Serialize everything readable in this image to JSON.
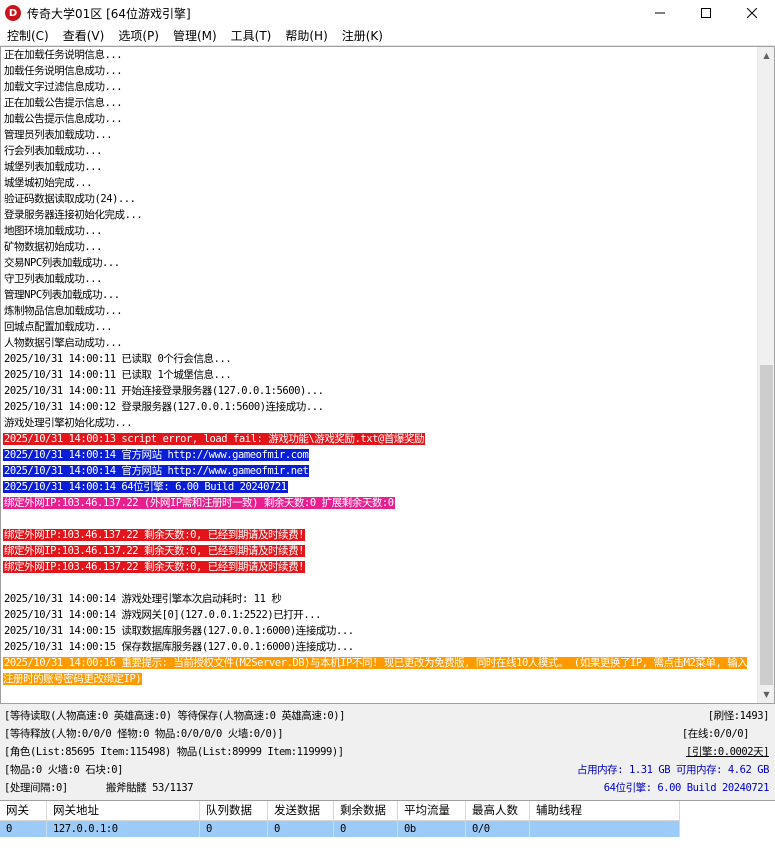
{
  "window": {
    "title": "传奇大学01区 [64位游戏引擎]",
    "app_icon_letter": "D",
    "minimize_icon": "minimize-icon",
    "maximize_icon": "maximize-icon",
    "close_icon": "close-icon"
  },
  "menu": [
    {
      "label": "控制(C)"
    },
    {
      "label": "查看(V)"
    },
    {
      "label": "选项(P)"
    },
    {
      "label": "管理(M)"
    },
    {
      "label": "工具(T)"
    },
    {
      "label": "帮助(H)"
    },
    {
      "label": "注册(K)"
    }
  ],
  "log": [
    {
      "text": "正在加载任务说明信息...",
      "style": "plain"
    },
    {
      "text": "加载任务说明信息成功...",
      "style": "plain"
    },
    {
      "text": "加载文字过滤信息成功...",
      "style": "plain"
    },
    {
      "text": "正在加载公告提示信息...",
      "style": "plain"
    },
    {
      "text": "加载公告提示信息成功...",
      "style": "plain"
    },
    {
      "text": "管理员列表加载成功...",
      "style": "plain"
    },
    {
      "text": "行会列表加载成功...",
      "style": "plain"
    },
    {
      "text": "城堡列表加载成功...",
      "style": "plain"
    },
    {
      "text": "城堡城初始完成...",
      "style": "plain"
    },
    {
      "text": "验证码数据读取成功(24)...",
      "style": "plain"
    },
    {
      "text": "登录服务器连接初始化完成...",
      "style": "plain"
    },
    {
      "text": "地图环境加载成功...",
      "style": "plain"
    },
    {
      "text": "矿物数据初始成功...",
      "style": "plain"
    },
    {
      "text": "交易NPC列表加载成功...",
      "style": "plain"
    },
    {
      "text": "守卫列表加载成功...",
      "style": "plain"
    },
    {
      "text": "管理NPC列表加载成功...",
      "style": "plain"
    },
    {
      "text": "炼制物品信息加载成功...",
      "style": "plain"
    },
    {
      "text": "回城点配置加载成功...",
      "style": "plain"
    },
    {
      "text": "人物数据引擎启动成功...",
      "style": "plain"
    },
    {
      "text": "2025/10/31 14:00:11 已读取 0个行会信息...",
      "style": "plain"
    },
    {
      "text": "2025/10/31 14:00:11 已读取 1个城堡信息...",
      "style": "plain"
    },
    {
      "text": "2025/10/31 14:00:11 开始连接登录服务器(127.0.0.1:5600)...",
      "style": "plain"
    },
    {
      "text": "2025/10/31 14:00:12 登录服务器(127.0.0.1:5600)连接成功...",
      "style": "plain"
    },
    {
      "text": "游戏处理引擎初始化成功...",
      "style": "plain"
    },
    {
      "text": "2025/10/31 14:00:13 script error, load fail: 游戏功能\\游戏奖励.txt@首爆奖励",
      "style": "red"
    },
    {
      "text": "2025/10/31 14:00:14 官方网站 http://www.gameofmir.com",
      "style": "blue"
    },
    {
      "text": "2025/10/31 14:00:14 官方网站 http://www.gameofmir.net",
      "style": "blue"
    },
    {
      "text": "2025/10/31 14:00:14 64位引擎: 6.00 Build 20240721",
      "style": "blue"
    },
    {
      "text": "绑定外网IP:103.46.137.22 (外网IP需和注册时一致) 剩余天数:0 扩展剩余天数:0",
      "style": "pink"
    },
    {
      "text": "",
      "style": "plain"
    },
    {
      "text": "绑定外网IP:103.46.137.22 剩余天数:0, 已经到期请及时续费!",
      "style": "red"
    },
    {
      "text": "绑定外网IP:103.46.137.22 剩余天数:0, 已经到期请及时续费!",
      "style": "red"
    },
    {
      "text": "绑定外网IP:103.46.137.22 剩余天数:0, 已经到期请及时续费!",
      "style": "red"
    },
    {
      "text": "",
      "style": "plain"
    },
    {
      "text": "2025/10/31 14:00:14 游戏处理引擎本次启动耗时: 11 秒",
      "style": "plain"
    },
    {
      "text": "2025/10/31 14:00:14 游戏网关[0](127.0.0.1:2522)已打开...",
      "style": "plain"
    },
    {
      "text": "2025/10/31 14:00:15 读取数据库服务器(127.0.0.1:6000)连接成功...",
      "style": "plain"
    },
    {
      "text": "2025/10/31 14:00:15 保存数据库服务器(127.0.0.1:6000)连接成功...",
      "style": "plain"
    },
    {
      "text": "2025/10/31 14:00:16 重要提示: 当前授权文件(M2Server.DB)与本机IP不同! 现已更改为免费版, 同时在线10人模式。 (如果更换了IP, 需点击M2菜单, 输入注册时的账号密码更改绑定IP)",
      "style": "orange"
    }
  ],
  "status": {
    "wait_read": "[等待读取(人物高速:0 英雄高速:0) 等待保存(人物高速:0 英雄高速:0)]",
    "wait_release": "[等待释放(人物:0/0/0 怪物:0 物品:0/0/0/0 火墙:0/0)]",
    "lists": "[角色(List:85695 Item:115498) 物品(List:89999 Item:119999)]",
    "items": "[物品:0 火墙:0 石块:0]",
    "process": "[处理间隔:0]",
    "skeleton": "搬斧骷髅 53/1137",
    "refresh": "[刷怪:1493]",
    "online": "[在线:0/0/0]",
    "engine": "[引擎:0.0002天]",
    "memory": "占用内存: 1.31 GB 可用内存: 4.62 GB",
    "version": "64位引擎: 6.00 Build 20240721"
  },
  "gateway_table": {
    "headers": [
      "网关",
      "网关地址",
      "队列数据",
      "发送数据",
      "剩余数据",
      "平均流量",
      "最高人数",
      "辅助线程"
    ],
    "rows": [
      [
        "0",
        "127.0.0.1:0",
        "0",
        "0",
        "0",
        "0b",
        "0/0",
        ""
      ]
    ]
  },
  "colors": {
    "red": "#e3141a",
    "blue": "#0a1ed8",
    "pink": "#e8208f",
    "orange": "#ff9a00",
    "selected_row": "#9dcbf7",
    "status_blue": "#0000c8"
  }
}
